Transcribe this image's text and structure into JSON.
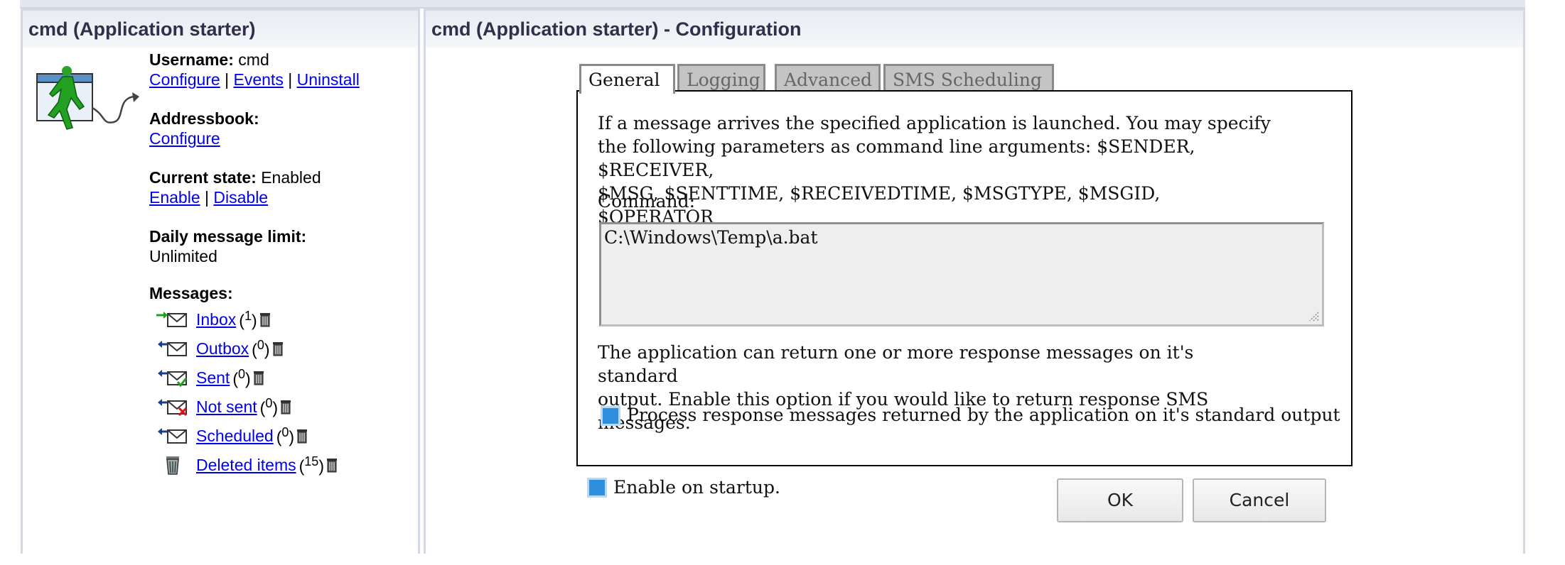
{
  "left_panel": {
    "title": "cmd (Application starter)",
    "username_label": "Username:",
    "username_value": "cmd",
    "links1": [
      "Configure",
      "Events",
      "Uninstall"
    ],
    "sep": "|",
    "addressbook_label": "Addressbook:",
    "addressbook_link": "Configure",
    "state_label": "Current state:",
    "state_value": "Enabled",
    "state_links": [
      "Enable",
      "Disable"
    ],
    "limit_label": "Daily message limit:",
    "limit_value": "Unlimited",
    "messages_label": "Messages:",
    "folders": [
      {
        "name": "Inbox",
        "count": "1",
        "icon": "inbox-envelope-icon"
      },
      {
        "name": "Outbox",
        "count": "0",
        "icon": "outbox-envelope-icon"
      },
      {
        "name": "Sent",
        "count": "0",
        "icon": "sent-envelope-icon"
      },
      {
        "name": "Not sent",
        "count": "0",
        "icon": "not-sent-envelope-icon"
      },
      {
        "name": "Scheduled",
        "count": "0",
        "icon": "scheduled-envelope-icon"
      },
      {
        "name": "Deleted items",
        "count": "15",
        "icon": "trash-can-icon"
      }
    ]
  },
  "right_panel": {
    "title": "cmd (Application starter) - Configuration",
    "tabs": [
      "General",
      "Logging",
      "Advanced",
      "SMS Scheduling"
    ],
    "active_tab": "General",
    "intro_lines": [
      "If a message arrives the specified application is launched. You may specify",
      "the following parameters as command line arguments: $SENDER,",
      "$RECEIVER,",
      "$MSG, $SENTTIME, $RECEIVEDTIME, $MSGTYPE, $MSGID,",
      "$OPERATOR"
    ],
    "command_label": "Command:",
    "command_value": "C:\\Windows\\Temp\\a.bat",
    "response_lines": [
      "The application can return one or more response messages on it's",
      "standard",
      "output. Enable this option if you would like to return response SMS",
      "messages."
    ],
    "process_checkbox_label": "Process response messages returned by the application on it's standard output",
    "startup_checkbox_label": "Enable on startup.",
    "ok_label": "OK",
    "cancel_label": "Cancel"
  }
}
